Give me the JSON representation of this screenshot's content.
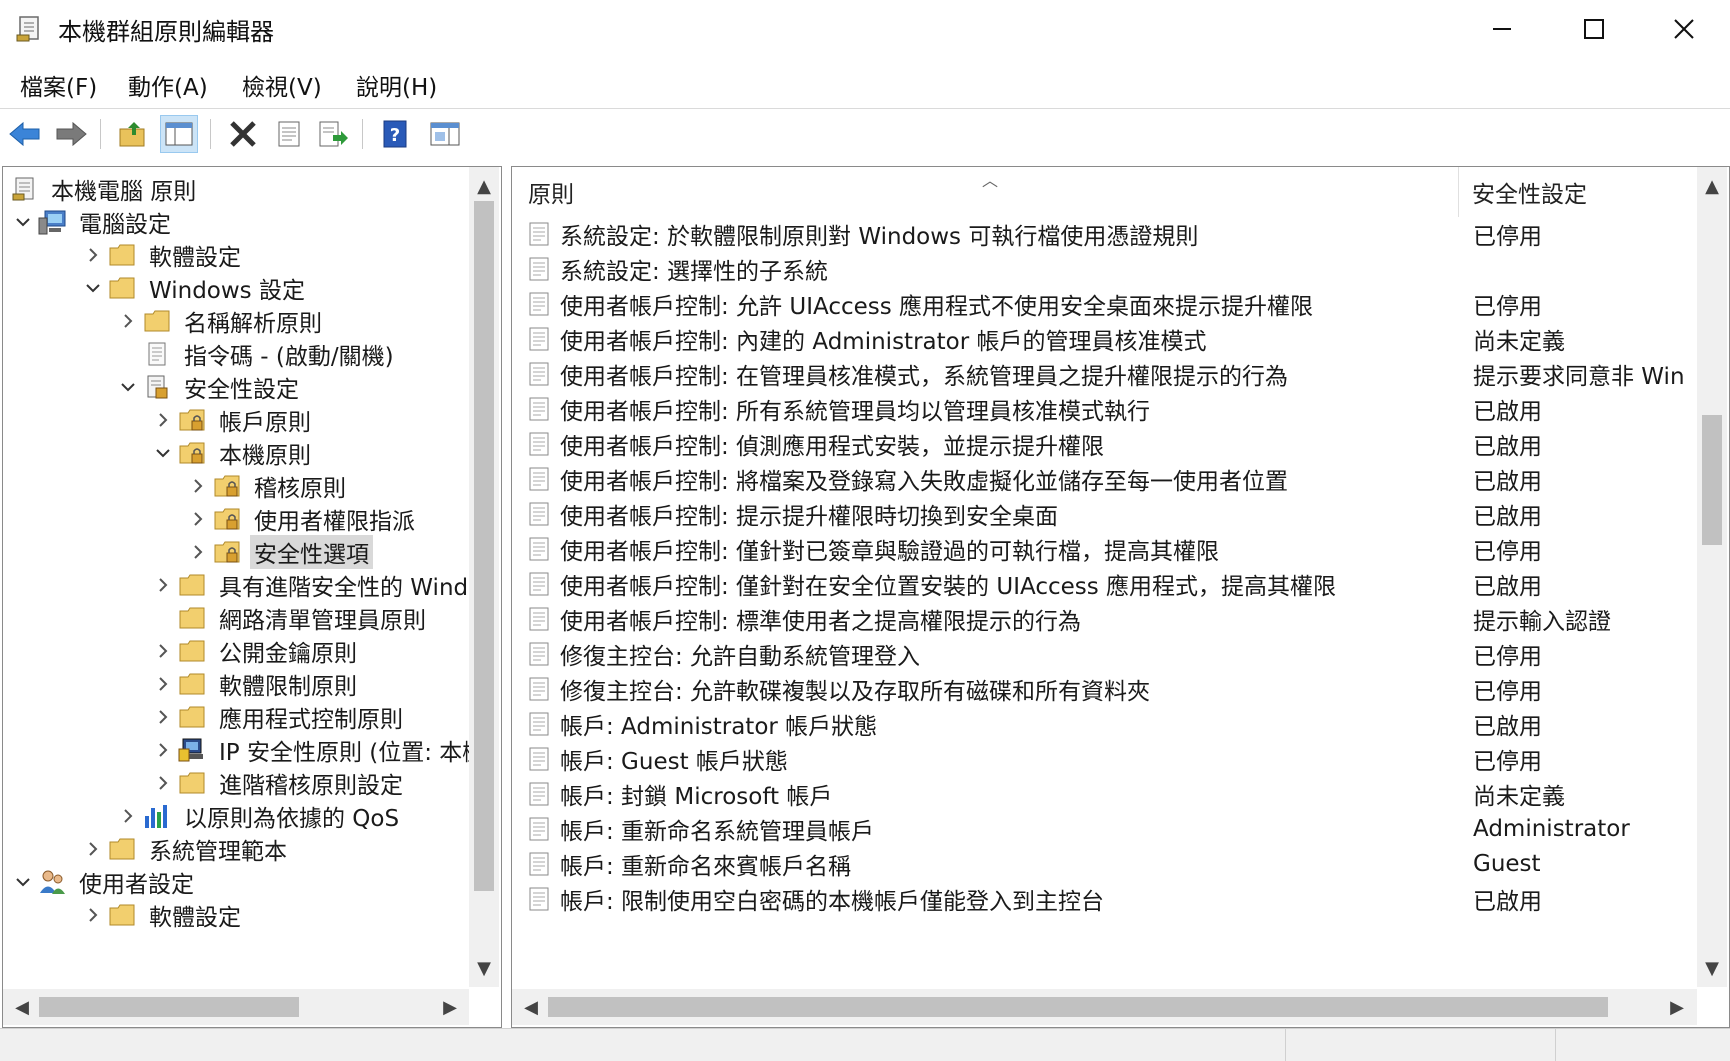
{
  "window": {
    "title": "本機群組原則編輯器"
  },
  "menu": [
    {
      "label": "檔案(F)"
    },
    {
      "label": "動作(A)"
    },
    {
      "label": "檢視(V)"
    },
    {
      "label": "說明(H)"
    }
  ],
  "toolbar": {
    "buttons": [
      {
        "icon": "back-arrow-icon"
      },
      {
        "icon": "forward-arrow-icon"
      },
      {
        "icon": "up-folder-icon"
      },
      {
        "icon": "show-hide-console-tree-icon"
      },
      {
        "icon": "delete-icon"
      },
      {
        "icon": "properties-icon"
      },
      {
        "icon": "export-list-icon"
      },
      {
        "icon": "help-icon"
      },
      {
        "icon": "show-action-pane-icon"
      }
    ]
  },
  "tree": {
    "items": [
      {
        "label": "本機電腦 原則"
      },
      {
        "label": "電腦設定"
      },
      {
        "label": "軟體設定"
      },
      {
        "label": "Windows 設定"
      },
      {
        "label": "名稱解析原則"
      },
      {
        "label": "指令碼 - (啟動/關機)"
      },
      {
        "label": "安全性設定"
      },
      {
        "label": "帳戶原則"
      },
      {
        "label": "本機原則"
      },
      {
        "label": "稽核原則"
      },
      {
        "label": "使用者權限指派"
      },
      {
        "label": "安全性選項"
      },
      {
        "label": "具有進階安全性的 Wind"
      },
      {
        "label": "網路清單管理員原則"
      },
      {
        "label": "公開金鑰原則"
      },
      {
        "label": "軟體限制原則"
      },
      {
        "label": "應用程式控制原則"
      },
      {
        "label": "IP 安全性原則 (位置: 本機"
      },
      {
        "label": "進階稽核原則設定"
      },
      {
        "label": "以原則為依據的 QoS"
      },
      {
        "label": "系統管理範本"
      },
      {
        "label": "使用者設定"
      },
      {
        "label": "軟體設定"
      }
    ]
  },
  "list": {
    "columns": {
      "policy": "原則",
      "setting": "安全性設定"
    },
    "rows": [
      {
        "policy": "系統設定: 於軟體限制原則對 Windows 可執行檔使用憑證規則",
        "setting": "已停用"
      },
      {
        "policy": "系統設定: 選擇性的子系統",
        "setting": ""
      },
      {
        "policy": "使用者帳戶控制: 允許 UIAccess 應用程式不使用安全桌面來提示提升權限",
        "setting": "已停用"
      },
      {
        "policy": "使用者帳戶控制: 內建的 Administrator 帳戶的管理員核准模式",
        "setting": "尚未定義"
      },
      {
        "policy": "使用者帳戶控制: 在管理員核准模式，系統管理員之提升權限提示的行為",
        "setting": "提示要求同意非 Win"
      },
      {
        "policy": "使用者帳戶控制: 所有系統管理員均以管理員核准模式執行",
        "setting": "已啟用"
      },
      {
        "policy": "使用者帳戶控制: 偵測應用程式安裝，並提示提升權限",
        "setting": "已啟用"
      },
      {
        "policy": "使用者帳戶控制: 將檔案及登錄寫入失敗虛擬化並儲存至每一使用者位置",
        "setting": "已啟用"
      },
      {
        "policy": "使用者帳戶控制: 提示提升權限時切換到安全桌面",
        "setting": "已啟用"
      },
      {
        "policy": "使用者帳戶控制: 僅針對已簽章與驗證過的可執行檔，提高其權限",
        "setting": "已停用"
      },
      {
        "policy": "使用者帳戶控制: 僅針對在安全位置安裝的 UIAccess 應用程式，提高其權限",
        "setting": "已啟用"
      },
      {
        "policy": "使用者帳戶控制: 標準使用者之提高權限提示的行為",
        "setting": "提示輸入認證"
      },
      {
        "policy": "修復主控台: 允許自動系統管理登入",
        "setting": "已停用"
      },
      {
        "policy": "修復主控台: 允許軟碟複製以及存取所有磁碟和所有資料夾",
        "setting": "已停用"
      },
      {
        "policy": "帳戶: Administrator 帳戶狀態",
        "setting": "已啟用"
      },
      {
        "policy": "帳戶: Guest 帳戶狀態",
        "setting": "已停用"
      },
      {
        "policy": "帳戶: 封鎖 Microsoft 帳戶",
        "setting": "尚未定義"
      },
      {
        "policy": "帳戶: 重新命名系統管理員帳戶",
        "setting": "Administrator"
      },
      {
        "policy": "帳戶: 重新命名來賓帳戶名稱",
        "setting": "Guest"
      },
      {
        "policy": "帳戶: 限制使用空白密碼的本機帳戶僅能登入到主控台",
        "setting": "已啟用"
      }
    ]
  }
}
